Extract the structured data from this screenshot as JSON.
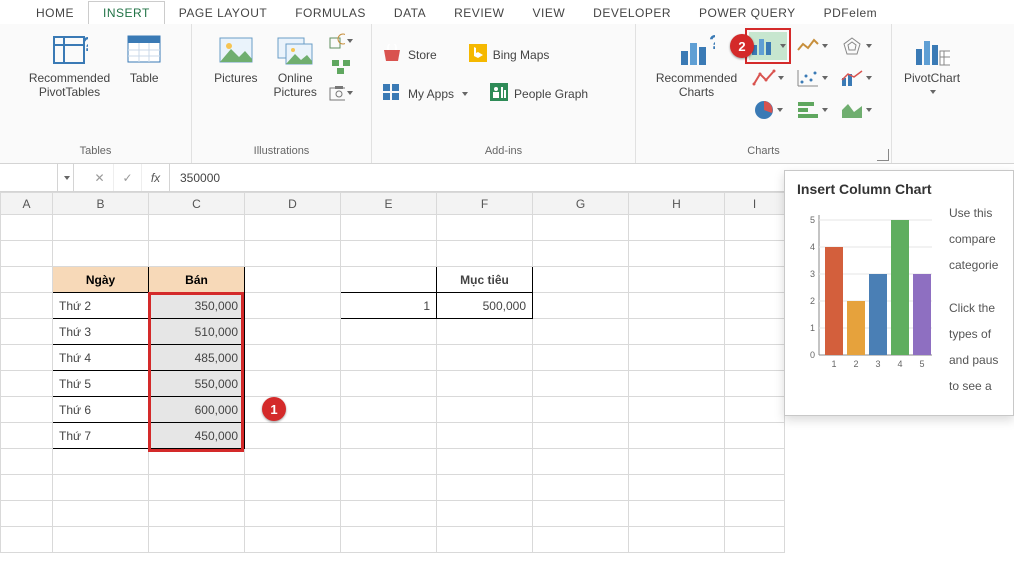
{
  "tabs": [
    "HOME",
    "INSERT",
    "PAGE LAYOUT",
    "FORMULAS",
    "DATA",
    "REVIEW",
    "VIEW",
    "DEVELOPER",
    "POWER QUERY",
    "PDFelem"
  ],
  "active_tab": "INSERT",
  "ribbon": {
    "tables": {
      "rec_pivot": "Recommended\nPivotTables",
      "table": "Table",
      "label": "Tables"
    },
    "illus": {
      "pictures": "Pictures",
      "online": "Online\nPictures",
      "label": "Illustrations"
    },
    "addins": {
      "store": "Store",
      "myapps": "My Apps",
      "bing": "Bing Maps",
      "people": "People Graph",
      "label": "Add-ins"
    },
    "charts": {
      "rec": "Recommended\nCharts",
      "label": "Charts",
      "pivot": "PivotChart"
    }
  },
  "formula_bar": {
    "name": "",
    "value": "350000"
  },
  "columns": [
    "A",
    "B",
    "C",
    "D",
    "E",
    "F",
    "G",
    "H",
    "I"
  ],
  "sheet": {
    "headers": {
      "day": "Ngày",
      "sold": "Bán",
      "target": "Mục tiêu"
    },
    "rows": [
      {
        "day": "Thứ 2",
        "sold": "350,000"
      },
      {
        "day": "Thứ 3",
        "sold": "510,000"
      },
      {
        "day": "Thứ 4",
        "sold": "485,000"
      },
      {
        "day": "Thứ 5",
        "sold": "550,000"
      },
      {
        "day": "Thứ 6",
        "sold": "600,000"
      },
      {
        "day": "Thứ 7",
        "sold": "450,000"
      }
    ],
    "target_row": {
      "n": "1",
      "v": "500,000"
    }
  },
  "callouts": {
    "one": "1",
    "two": "2"
  },
  "screentip": {
    "title": "Insert Column Chart",
    "p1": "Use this",
    "p2": "compare",
    "p3": "categorie",
    "p4": "Click the",
    "p5": "types of",
    "p6": "and paus",
    "p7": "to see a"
  },
  "chart_data": {
    "type": "bar",
    "title": "",
    "categories": [
      "1",
      "2",
      "3",
      "4",
      "5"
    ],
    "values": [
      4,
      2,
      3,
      5,
      3
    ],
    "ylim": [
      0,
      5
    ],
    "xlabel": "",
    "ylabel": ""
  }
}
